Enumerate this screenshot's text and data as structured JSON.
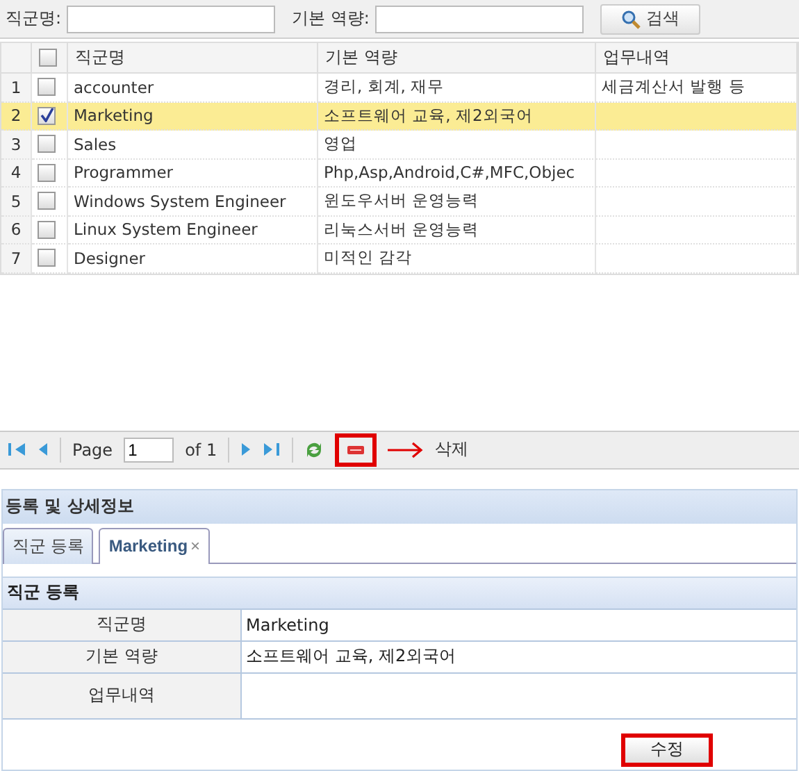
{
  "search": {
    "fields": [
      {
        "label": "직군명:"
      },
      {
        "label": "기본 역량:"
      }
    ],
    "button": "검색"
  },
  "table": {
    "header_checked": false,
    "columns": [
      "직군명",
      "기본 역량",
      "업무내역"
    ],
    "rows": [
      {
        "num": "1",
        "checked": false,
        "selected": false,
        "name": "accounter",
        "ability": "경리, 회계, 재무",
        "work": "세금계산서 발행 등"
      },
      {
        "num": "2",
        "checked": true,
        "selected": true,
        "name": "Marketing",
        "ability": "소프트웨어 교육, 제2외국어"
      },
      {
        "num": "3",
        "checked": false,
        "selected": false,
        "name": "Sales",
        "ability": "영업"
      },
      {
        "num": "4",
        "checked": false,
        "selected": false,
        "name": "Programmer",
        "ability": "Php,Asp,Android,C#,MFC,Objec"
      },
      {
        "num": "5",
        "checked": false,
        "selected": false,
        "name": "Windows System Engineer",
        "ability": "윈도우서버 운영능력"
      },
      {
        "num": "6",
        "checked": false,
        "selected": false,
        "name": "Linux System Engineer",
        "ability": "리눅스서버 운영능력"
      },
      {
        "num": "7",
        "checked": false,
        "selected": false,
        "name": "Designer",
        "ability": "미적인 감각"
      }
    ]
  },
  "pager": {
    "page_label": "Page",
    "page_value": "1",
    "of_label": "of 1",
    "annotation": "삭제"
  },
  "panel": {
    "title": "등록 및 상세정보",
    "tabs": [
      {
        "label": "직군 등록",
        "selected": false
      },
      {
        "label": "Marketing",
        "selected": true,
        "close": "×"
      }
    ],
    "section": {
      "title": "직군 등록",
      "fields": [
        {
          "label": "직군명",
          "value": "Marketing"
        },
        {
          "label": "기본 역량",
          "value": "소프트웨어 교육, 제2외국어"
        },
        {
          "label": "업무내역"
        }
      ],
      "button": "수정"
    }
  }
}
